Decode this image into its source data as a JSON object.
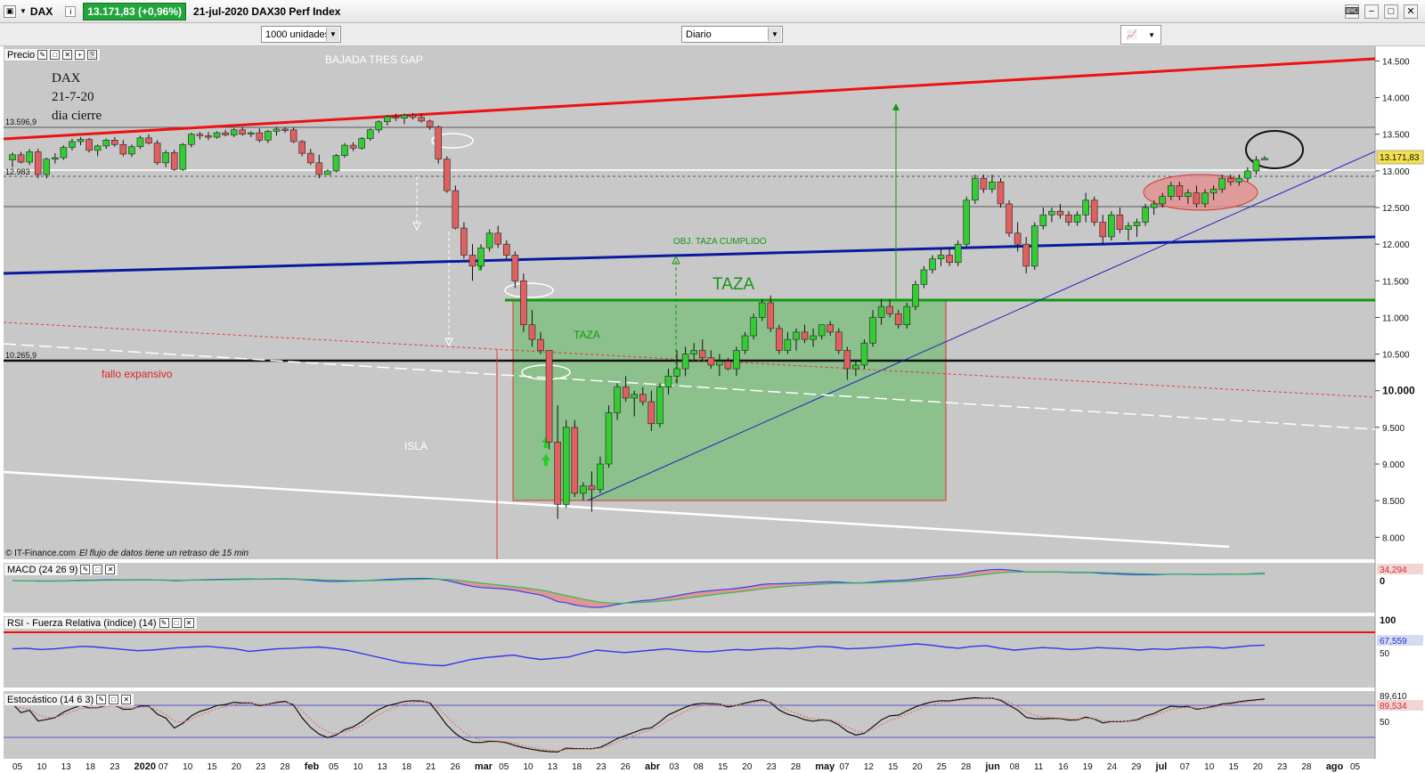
{
  "titlebar": {
    "symbol": "DAX",
    "price_change": "13.171,83 (+0,96%)",
    "subtitle": "21-jul-2020 DAX30 Perf Index"
  },
  "toolbar": {
    "units_select": "1000 unidades",
    "period_select": "Diario"
  },
  "colors": {
    "chart_bg": "#c8c8c8",
    "up_candle": "#33cc33",
    "down_candle": "#e06060",
    "red_trend": "#ee1111",
    "blue_trend": "#0a1aa0",
    "green_line": "#119911",
    "taza_box": "#8cc08c"
  },
  "price_panel": {
    "label": "Precio",
    "annotations": {
      "dax": "DAX",
      "date": "21-7-20",
      "cierre": "dia cierre",
      "bajada": "BAJADA TRES GAP",
      "obj_taza": "OBJ. TAZA CUMPLIDO",
      "taza_big": "TAZA",
      "taza_small": "TAZA",
      "fallo": "fallo expansivo",
      "isla": "ISLA",
      "level_high": "13.596,9",
      "level_low": "10.265,9",
      "level_mid": "12.983",
      "copyright": "© IT-Finance.com",
      "delay_note": "El flujo de datos tiene un retraso de 15 min"
    },
    "y_ticks": [
      "14.500",
      "14.000",
      "13.500",
      "13.000",
      "12.500",
      "12.000",
      "11.500",
      "11.000",
      "10.500",
      "10.000",
      "9.500",
      "9.000",
      "8.500",
      "8.000"
    ],
    "last_price_label": "13.171,83"
  },
  "macd_panel": {
    "label": "MACD (24 26 9)",
    "value_label": "34,294",
    "tick": "0"
  },
  "rsi_panel": {
    "label": "RSI - Fuerza Relativa (índice) (14)",
    "value_label": "67,559",
    "tick_high": "100",
    "tick_mid": "50"
  },
  "stoch_panel": {
    "label": "Estocástico (14 6 3)",
    "value_label_1": "89,610",
    "value_label_2": "89,534",
    "tick_mid": "50"
  },
  "x_axis": {
    "labels": [
      "05",
      "10",
      "13",
      "18",
      "23",
      "2020",
      "07",
      "10",
      "15",
      "20",
      "23",
      "28",
      "feb",
      "05",
      "10",
      "13",
      "18",
      "21",
      "26",
      "mar",
      "05",
      "10",
      "13",
      "18",
      "23",
      "26",
      "abr",
      "03",
      "08",
      "15",
      "20",
      "23",
      "28",
      "may",
      "07",
      "12",
      "15",
      "20",
      "25",
      "28",
      "jun",
      "08",
      "11",
      "16",
      "19",
      "24",
      "29",
      "jul",
      "07",
      "10",
      "15",
      "20",
      "23",
      "28",
      "ago",
      "05"
    ]
  },
  "chart_data": {
    "type": "candlestick",
    "title": "21-jul-2020 DAX30 Perf Index",
    "ylim": [
      7700,
      14700
    ],
    "ohlc": [
      [
        13150,
        13250,
        13050,
        13220
      ],
      [
        13220,
        13260,
        13100,
        13120
      ],
      [
        13120,
        13300,
        13080,
        13260
      ],
      [
        13260,
        13300,
        12900,
        12950
      ],
      [
        12950,
        13180,
        12900,
        13160
      ],
      [
        13160,
        13240,
        13100,
        13180
      ],
      [
        13180,
        13350,
        13150,
        13320
      ],
      [
        13320,
        13440,
        13280,
        13400
      ],
      [
        13400,
        13460,
        13350,
        13430
      ],
      [
        13430,
        13450,
        13250,
        13280
      ],
      [
        13280,
        13360,
        13200,
        13340
      ],
      [
        13340,
        13440,
        13300,
        13420
      ],
      [
        13420,
        13460,
        13330,
        13360
      ],
      [
        13360,
        13420,
        13200,
        13230
      ],
      [
        13230,
        13360,
        13190,
        13330
      ],
      [
        13330,
        13480,
        13300,
        13450
      ],
      [
        13450,
        13500,
        13360,
        13380
      ],
      [
        13380,
        13420,
        13080,
        13110
      ],
      [
        13110,
        13280,
        13050,
        13250
      ],
      [
        13250,
        13290,
        13000,
        13020
      ],
      [
        13020,
        13380,
        13000,
        13360
      ],
      [
        13360,
        13520,
        13320,
        13500
      ],
      [
        13500,
        13530,
        13430,
        13480
      ],
      [
        13480,
        13530,
        13420,
        13460
      ],
      [
        13460,
        13540,
        13440,
        13520
      ],
      [
        13520,
        13560,
        13470,
        13490
      ],
      [
        13490,
        13580,
        13460,
        13560
      ],
      [
        13560,
        13600,
        13480,
        13500
      ],
      [
        13500,
        13540,
        13460,
        13520
      ],
      [
        13520,
        13580,
        13390,
        13420
      ],
      [
        13420,
        13560,
        13380,
        13540
      ],
      [
        13540,
        13600,
        13480,
        13570
      ],
      [
        13570,
        13600,
        13520,
        13560
      ],
      [
        13560,
        13590,
        13380,
        13400
      ],
      [
        13400,
        13420,
        13200,
        13240
      ],
      [
        13240,
        13300,
        13080,
        13110
      ],
      [
        13110,
        13220,
        12900,
        12950
      ],
      [
        12950,
        13020,
        12960,
        13000
      ],
      [
        13000,
        13230,
        12980,
        13210
      ],
      [
        13210,
        13380,
        13180,
        13350
      ],
      [
        13350,
        13390,
        13270,
        13310
      ],
      [
        13310,
        13460,
        13290,
        13440
      ],
      [
        13440,
        13580,
        13410,
        13560
      ],
      [
        13560,
        13690,
        13520,
        13670
      ],
      [
        13670,
        13760,
        13620,
        13740
      ],
      [
        13740,
        13780,
        13680,
        13720
      ],
      [
        13720,
        13780,
        13640,
        13760
      ],
      [
        13760,
        13790,
        13700,
        13730
      ],
      [
        13730,
        13780,
        13660,
        13680
      ],
      [
        13680,
        13700,
        13560,
        13600
      ],
      [
        13600,
        13620,
        13100,
        13160
      ],
      [
        13160,
        13200,
        12700,
        12730
      ],
      [
        12730,
        12800,
        12200,
        12220
      ],
      [
        12220,
        12300,
        11800,
        11850
      ],
      [
        11850,
        12000,
        11500,
        11700
      ],
      [
        11700,
        12000,
        11650,
        11950
      ],
      [
        11950,
        12200,
        11900,
        12150
      ],
      [
        12150,
        12250,
        11950,
        12000
      ],
      [
        12000,
        12050,
        11800,
        11850
      ],
      [
        11850,
        11900,
        11400,
        11500
      ],
      [
        11500,
        11600,
        10800,
        10900
      ],
      [
        10900,
        11100,
        10600,
        10700
      ],
      [
        10700,
        10800,
        10500,
        10550
      ],
      [
        10550,
        10500,
        9200,
        9300
      ],
      [
        9300,
        9800,
        8250,
        8450
      ],
      [
        8450,
        9600,
        8400,
        9500
      ],
      [
        9500,
        9600,
        8550,
        8600
      ],
      [
        8600,
        8750,
        8500,
        8700
      ],
      [
        8700,
        8900,
        8350,
        8650
      ],
      [
        8650,
        9100,
        8600,
        9000
      ],
      [
        9000,
        9800,
        8950,
        9700
      ],
      [
        9700,
        10100,
        9600,
        10050
      ],
      [
        10050,
        10200,
        9850,
        9900
      ],
      [
        9900,
        10000,
        9650,
        9950
      ],
      [
        9950,
        10050,
        9800,
        9850
      ],
      [
        9850,
        10000,
        9450,
        9550
      ],
      [
        9550,
        10100,
        9500,
        10050
      ],
      [
        10050,
        10300,
        9950,
        10200
      ],
      [
        10200,
        10550,
        10100,
        10300
      ],
      [
        10300,
        10600,
        10200,
        10500
      ],
      [
        10500,
        10650,
        10400,
        10550
      ],
      [
        10550,
        10700,
        10400,
        10450
      ],
      [
        10450,
        10550,
        10300,
        10350
      ],
      [
        10350,
        10500,
        10200,
        10400
      ],
      [
        10400,
        10450,
        10280,
        10300
      ],
      [
        10300,
        10600,
        10200,
        10550
      ],
      [
        10550,
        10800,
        10500,
        10750
      ],
      [
        10750,
        11050,
        10700,
        11000
      ],
      [
        11000,
        11250,
        10950,
        11200
      ],
      [
        11200,
        11300,
        10800,
        10850
      ],
      [
        10850,
        10900,
        10500,
        10550
      ],
      [
        10550,
        10800,
        10500,
        10700
      ],
      [
        10700,
        10850,
        10550,
        10800
      ],
      [
        10800,
        10900,
        10650,
        10700
      ],
      [
        10700,
        10850,
        10600,
        10750
      ],
      [
        10750,
        10900,
        10700,
        10900
      ],
      [
        10900,
        10950,
        10750,
        10800
      ],
      [
        10800,
        10850,
        10500,
        10550
      ],
      [
        10550,
        10600,
        10150,
        10300
      ],
      [
        10300,
        10400,
        10200,
        10350
      ],
      [
        10350,
        10700,
        10300,
        10650
      ],
      [
        10650,
        11100,
        10600,
        11000
      ],
      [
        11000,
        11250,
        10900,
        11150
      ],
      [
        11150,
        11250,
        11000,
        11050
      ],
      [
        11050,
        11100,
        10850,
        10900
      ],
      [
        10900,
        11200,
        10850,
        11150
      ],
      [
        11150,
        11500,
        11100,
        11450
      ],
      [
        11450,
        11700,
        11400,
        11650
      ],
      [
        11650,
        11850,
        11600,
        11800
      ],
      [
        11800,
        11950,
        11700,
        11850
      ],
      [
        11850,
        11950,
        11700,
        11750
      ],
      [
        11750,
        12050,
        11700,
        12000
      ],
      [
        12000,
        12650,
        11950,
        12600
      ],
      [
        12600,
        12950,
        12550,
        12900
      ],
      [
        12900,
        12950,
        12700,
        12750
      ],
      [
        12750,
        12950,
        12700,
        12850
      ],
      [
        12850,
        12900,
        12500,
        12550
      ],
      [
        12550,
        12600,
        12100,
        12150
      ],
      [
        12150,
        12300,
        11900,
        12000
      ],
      [
        12000,
        12100,
        11600,
        11700
      ],
      [
        11700,
        12300,
        11650,
        12250
      ],
      [
        12250,
        12500,
        12200,
        12400
      ],
      [
        12400,
        12500,
        12300,
        12450
      ],
      [
        12450,
        12550,
        12350,
        12400
      ],
      [
        12400,
        12450,
        12250,
        12300
      ],
      [
        12300,
        12450,
        12250,
        12400
      ],
      [
        12400,
        12700,
        12300,
        12600
      ],
      [
        12600,
        12650,
        12250,
        12300
      ],
      [
        12300,
        12400,
        12000,
        12100
      ],
      [
        12100,
        12450,
        12050,
        12400
      ],
      [
        12400,
        12500,
        12150,
        12200
      ],
      [
        12200,
        12300,
        12050,
        12250
      ],
      [
        12250,
        12350,
        12100,
        12300
      ],
      [
        12300,
        12550,
        12250,
        12500
      ],
      [
        12500,
        12600,
        12400,
        12550
      ],
      [
        12550,
        12700,
        12500,
        12650
      ],
      [
        12650,
        12850,
        12600,
        12800
      ],
      [
        12800,
        12850,
        12600,
        12650
      ],
      [
        12650,
        12750,
        12550,
        12700
      ],
      [
        12700,
        12800,
        12500,
        12550
      ],
      [
        12550,
        12750,
        12500,
        12700
      ],
      [
        12700,
        12800,
        12600,
        12750
      ],
      [
        12750,
        12950,
        12700,
        12900
      ],
      [
        12900,
        12950,
        12800,
        12850
      ],
      [
        12850,
        12950,
        12800,
        12900
      ],
      [
        12900,
        13050,
        12850,
        13000
      ],
      [
        13000,
        13200,
        12950,
        13150
      ],
      [
        13150,
        13200,
        13150,
        13171
      ]
    ],
    "rsi": [
      62,
      63,
      61,
      62,
      64,
      66,
      65,
      63,
      61,
      59,
      60,
      62,
      64,
      65,
      66,
      64,
      62,
      58,
      60,
      62,
      63,
      64,
      65,
      63,
      60,
      55,
      50,
      45,
      40,
      38,
      36,
      35,
      40,
      45,
      48,
      50,
      52,
      48,
      45,
      47,
      49,
      55,
      60,
      58,
      56,
      58,
      60,
      62,
      60,
      58,
      57,
      59,
      61,
      60,
      62,
      63,
      62,
      64,
      66,
      65,
      62,
      63,
      64,
      66,
      68,
      70,
      68,
      65,
      63,
      66,
      67,
      63,
      60,
      62,
      64,
      63,
      61,
      62,
      64,
      63,
      62,
      60,
      62,
      61,
      63,
      64,
      65,
      63,
      65,
      67,
      68
    ]
  }
}
